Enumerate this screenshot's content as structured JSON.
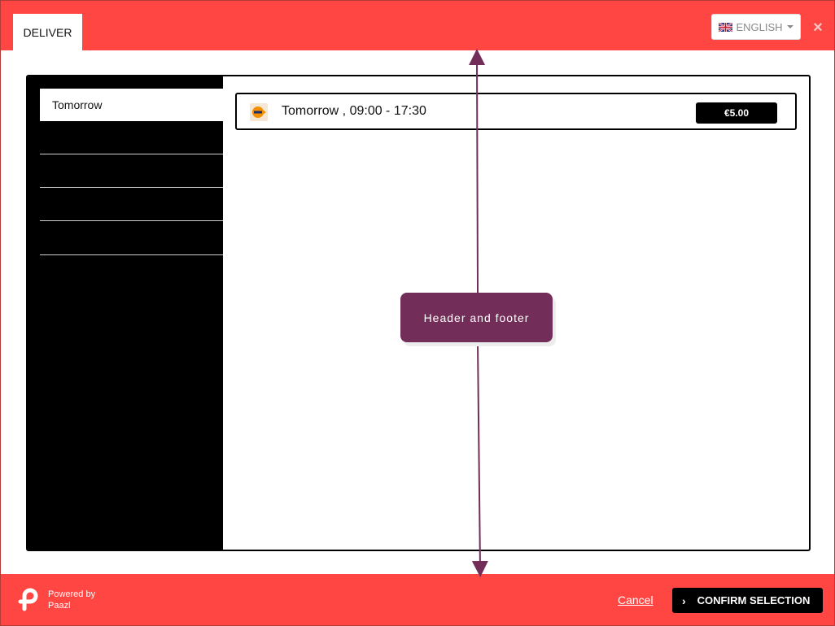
{
  "header": {
    "tab_label": "DELIVER",
    "language_label": "ENGLISH",
    "close_icon": "close-icon"
  },
  "sidebar": {
    "items": [
      {
        "label": "Tomorrow",
        "active": true
      },
      {
        "label": ""
      },
      {
        "label": ""
      },
      {
        "label": ""
      },
      {
        "label": ""
      }
    ]
  },
  "delivery_option": {
    "label": "Tomorrow , 09:00 - 17:30",
    "price": "€5.00",
    "carrier_icon": "postnl-logo-icon"
  },
  "footer": {
    "powered_line1": "Powered by",
    "powered_line2": "Paazl",
    "cancel_label": "Cancel",
    "confirm_label": "CONFIRM SELECTION"
  },
  "annotation": {
    "text": "Header and footer"
  },
  "colors": {
    "brand_red": "#ff4642",
    "annotation_purple": "#722e58",
    "dark": "#000000"
  }
}
